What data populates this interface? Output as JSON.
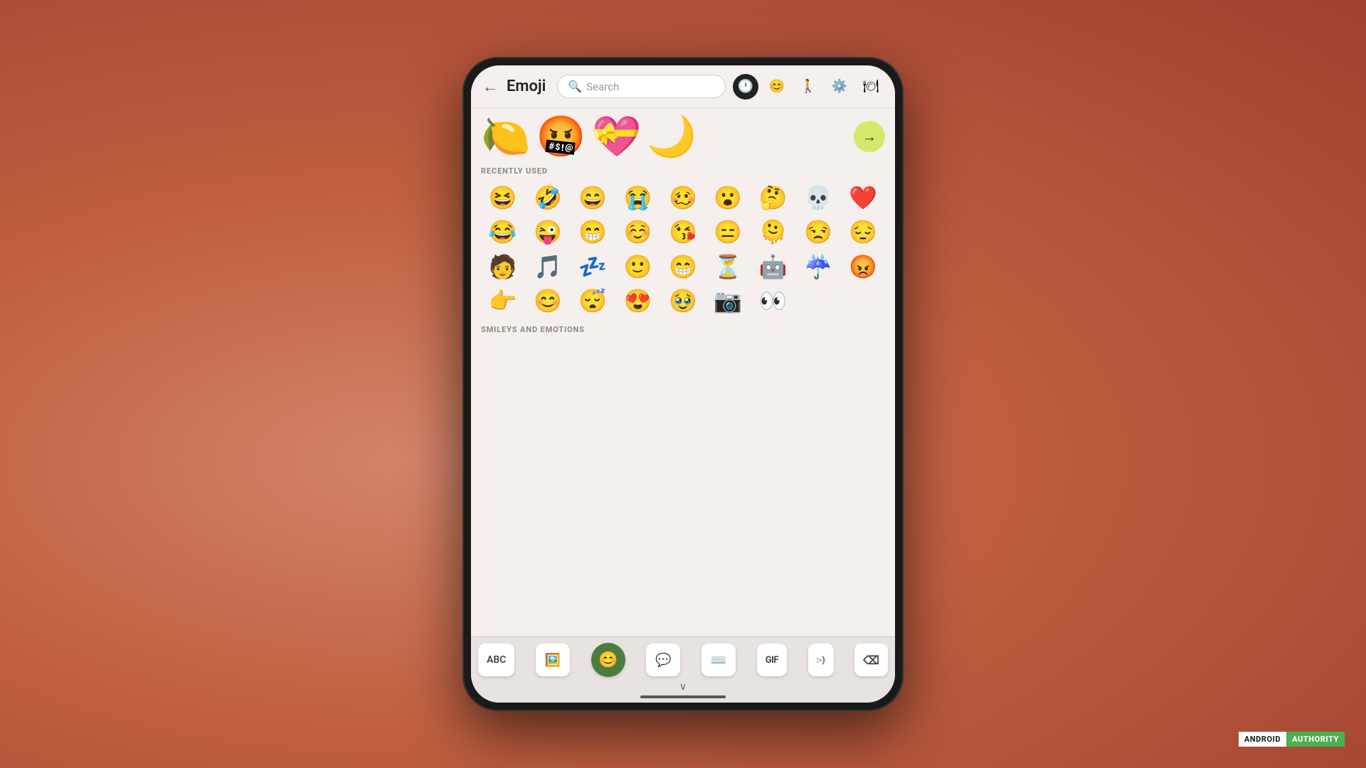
{
  "background": {
    "color": "#c9714e"
  },
  "header": {
    "back_arrow": "←",
    "title": "Emoji",
    "search_placeholder": "Search",
    "icons": [
      {
        "name": "clock-icon",
        "symbol": "🕐",
        "active": true,
        "dark": true
      },
      {
        "name": "smiley-icon",
        "symbol": "😊",
        "active": false
      },
      {
        "name": "person-icon",
        "symbol": "🚶",
        "active": false
      },
      {
        "name": "activities-icon",
        "symbol": "⚙",
        "active": false
      },
      {
        "name": "food-icon",
        "symbol": "🍽",
        "active": false
      }
    ]
  },
  "featured_emojis": [
    "🍋",
    "🤬",
    "💝",
    "🌙"
  ],
  "featured_arrow": "→",
  "sections": [
    {
      "label": "RECENTLY USED",
      "emojis": [
        "😆",
        "🤣",
        "😄",
        "😭",
        "🥴",
        "😮",
        "🤔",
        "💀",
        "❤️",
        "😂",
        "😜",
        "😁",
        "☺️",
        "😘",
        "😑",
        "🫠",
        "😒",
        "😔",
        "🧑",
        "🎵",
        "💤",
        "🙂",
        "😁",
        "⏳",
        "🤖",
        "☂️",
        "😡",
        "👉",
        "😊",
        "😴",
        "😍",
        "🥹",
        "📷",
        "👀",
        "",
        "",
        "",
        "",
        "",
        "",
        "",
        "",
        "",
        "",
        ""
      ]
    },
    {
      "label": "SMILEYS AND EMOTIONS",
      "emojis": []
    }
  ],
  "keyboard": {
    "abc_label": "ABC",
    "sticker_icon": "🖼",
    "emoji_icon": "😊",
    "chat_icon": "💬",
    "keyboard_icon": "⌨",
    "gif_label": "GIF",
    "text_face_label": ":-)",
    "delete_icon": "✕"
  },
  "watermark": {
    "android": "ANDROID",
    "authority": "AUTHORITY"
  },
  "nav_chevron": "∨"
}
